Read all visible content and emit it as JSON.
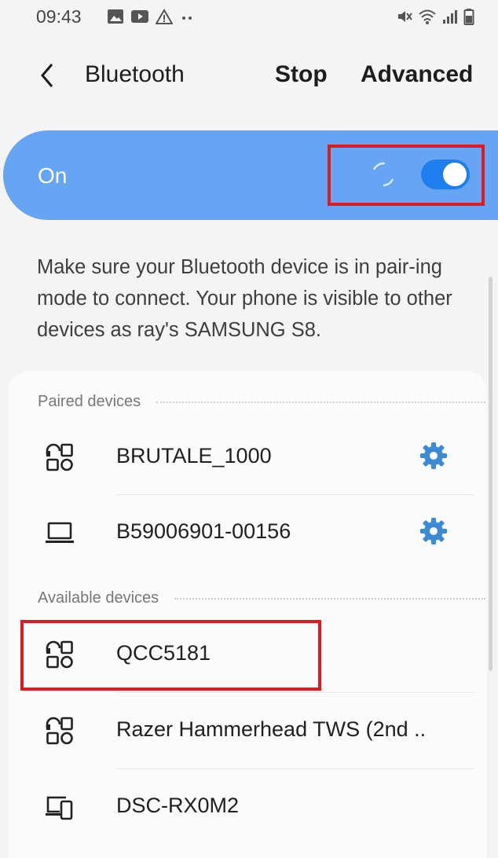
{
  "status_bar": {
    "time": "09:43",
    "notification_icons": [
      "image-icon",
      "video-icon",
      "warning-icon",
      "more-dots-icon"
    ],
    "status_icons": [
      "mute-icon",
      "wifi-icon",
      "signal-icon",
      "battery-icon"
    ]
  },
  "header": {
    "title": "Bluetooth",
    "stop_label": "Stop",
    "advanced_label": "Advanced"
  },
  "bluetooth": {
    "state_label": "On",
    "enabled": true,
    "scanning": true
  },
  "info_text": "Make sure your Bluetooth device is in pair-ing mode to connect. Your phone is visible to other devices as ray's SAMSUNG S8.",
  "paired": {
    "header": "Paired devices",
    "devices": [
      {
        "name": "BRUTALE_1000",
        "icon": "headset-icon",
        "settings": true
      },
      {
        "name": "B59006901-00156",
        "icon": "laptop-icon",
        "settings": true
      }
    ]
  },
  "available": {
    "header": "Available devices",
    "devices": [
      {
        "name": "QCC5181",
        "icon": "headset-icon"
      },
      {
        "name": "Razer Hammerhead TWS (2nd ..",
        "icon": "headset-icon"
      },
      {
        "name": "DSC-RX0M2",
        "icon": "multi-device-icon"
      }
    ]
  },
  "colors": {
    "accent": "#65a5f3",
    "toggle_on": "#1e7ef0",
    "gear": "#3a8ad8",
    "highlight": "#e11a1f"
  }
}
